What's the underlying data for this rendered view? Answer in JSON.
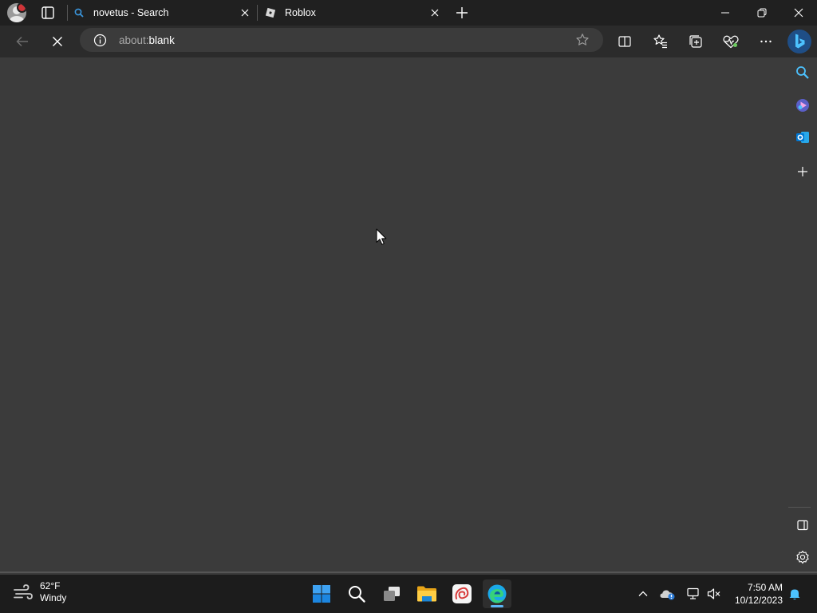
{
  "tabs": [
    {
      "title": "novetus - Search"
    },
    {
      "title": "Roblox"
    }
  ],
  "address_bar": {
    "url_prefix": "about:",
    "url_main": "blank"
  },
  "taskbar": {
    "weather": {
      "temperature": "62°F",
      "condition": "Windy"
    },
    "clock": {
      "time": "7:50 AM",
      "date": "10/12/2023"
    }
  },
  "colors": {
    "accent": "#0078d4",
    "tabbar": "#202020",
    "toolbar": "#2b2b2b",
    "content": "#3b3b3b",
    "taskbar": "#1c1c1c"
  },
  "icons": {
    "window_controls": [
      "minimize-icon",
      "restore-icon",
      "close-icon"
    ],
    "toolbar": [
      "back-icon",
      "stop-loading-icon",
      "split-screen-icon",
      "favorites-icon",
      "collections-icon",
      "browser-essentials-icon",
      "more-icon",
      "bing-icon"
    ],
    "sidebar": [
      "search-icon",
      "copilot-icon",
      "outlook-icon",
      "add-icon",
      "hide-sidebar-icon",
      "settings-icon"
    ],
    "taskbar": [
      "start-icon",
      "search-icon",
      "task-view-icon",
      "file-explorer-icon",
      "app-icon",
      "edge-icon"
    ]
  }
}
